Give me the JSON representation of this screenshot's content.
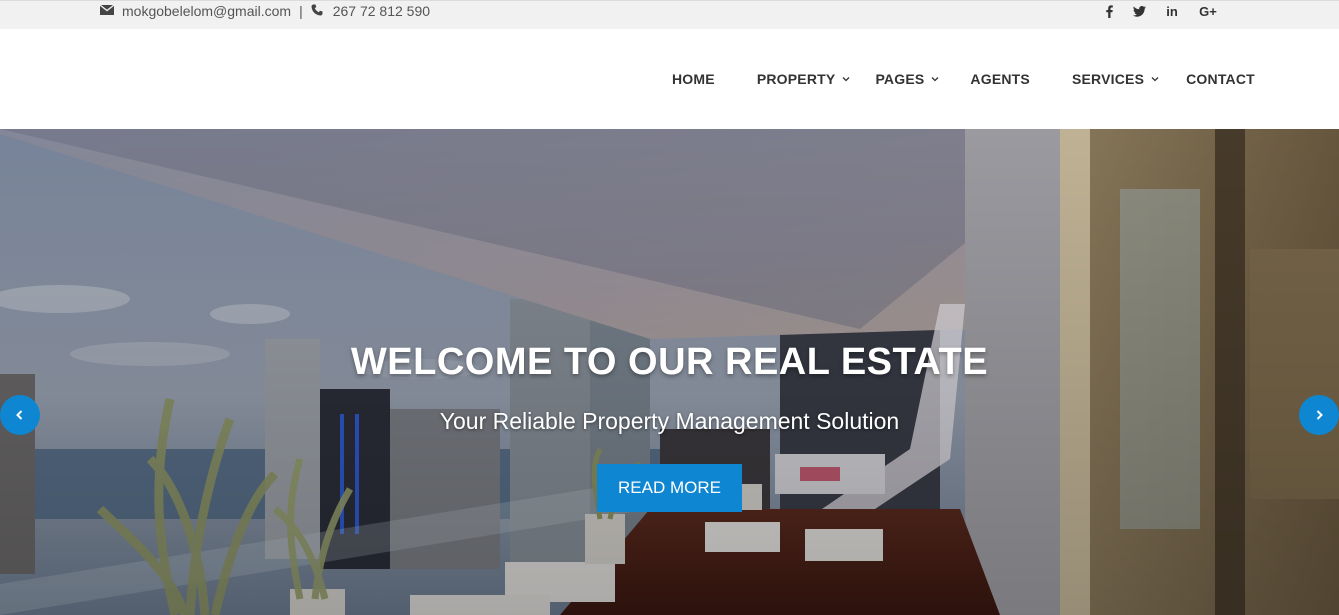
{
  "topbar": {
    "email": "mokgobelelom@gmail.com",
    "separator": "|",
    "phone": "267 72 812 590",
    "email_icon": "envelope-icon",
    "phone_icon": "phone-icon",
    "social": [
      {
        "icon": "facebook-icon",
        "glyph": "f"
      },
      {
        "icon": "twitter-icon",
        "glyph": ""
      },
      {
        "icon": "linkedin-icon",
        "glyph": "in"
      },
      {
        "icon": "google-plus-icon",
        "glyph": "G+"
      }
    ]
  },
  "nav": {
    "items": [
      {
        "label": "HOME"
      },
      {
        "label": "PROPERTY"
      },
      {
        "label": "PAGES"
      },
      {
        "label": "AGENTS"
      },
      {
        "label": "SERVICES"
      },
      {
        "label": "CONTACT"
      }
    ]
  },
  "hero": {
    "title": "WELCOME TO OUR REAL ESTATE",
    "subtitle": "Your Reliable Property Management Solution",
    "button_label": "READ MORE",
    "prev_icon": "chevron-left-icon",
    "next_icon": "chevron-right-icon"
  },
  "colors": {
    "accent": "#0f86d1",
    "topbar_bg": "#f1f1f1",
    "nav_text": "#333333"
  }
}
